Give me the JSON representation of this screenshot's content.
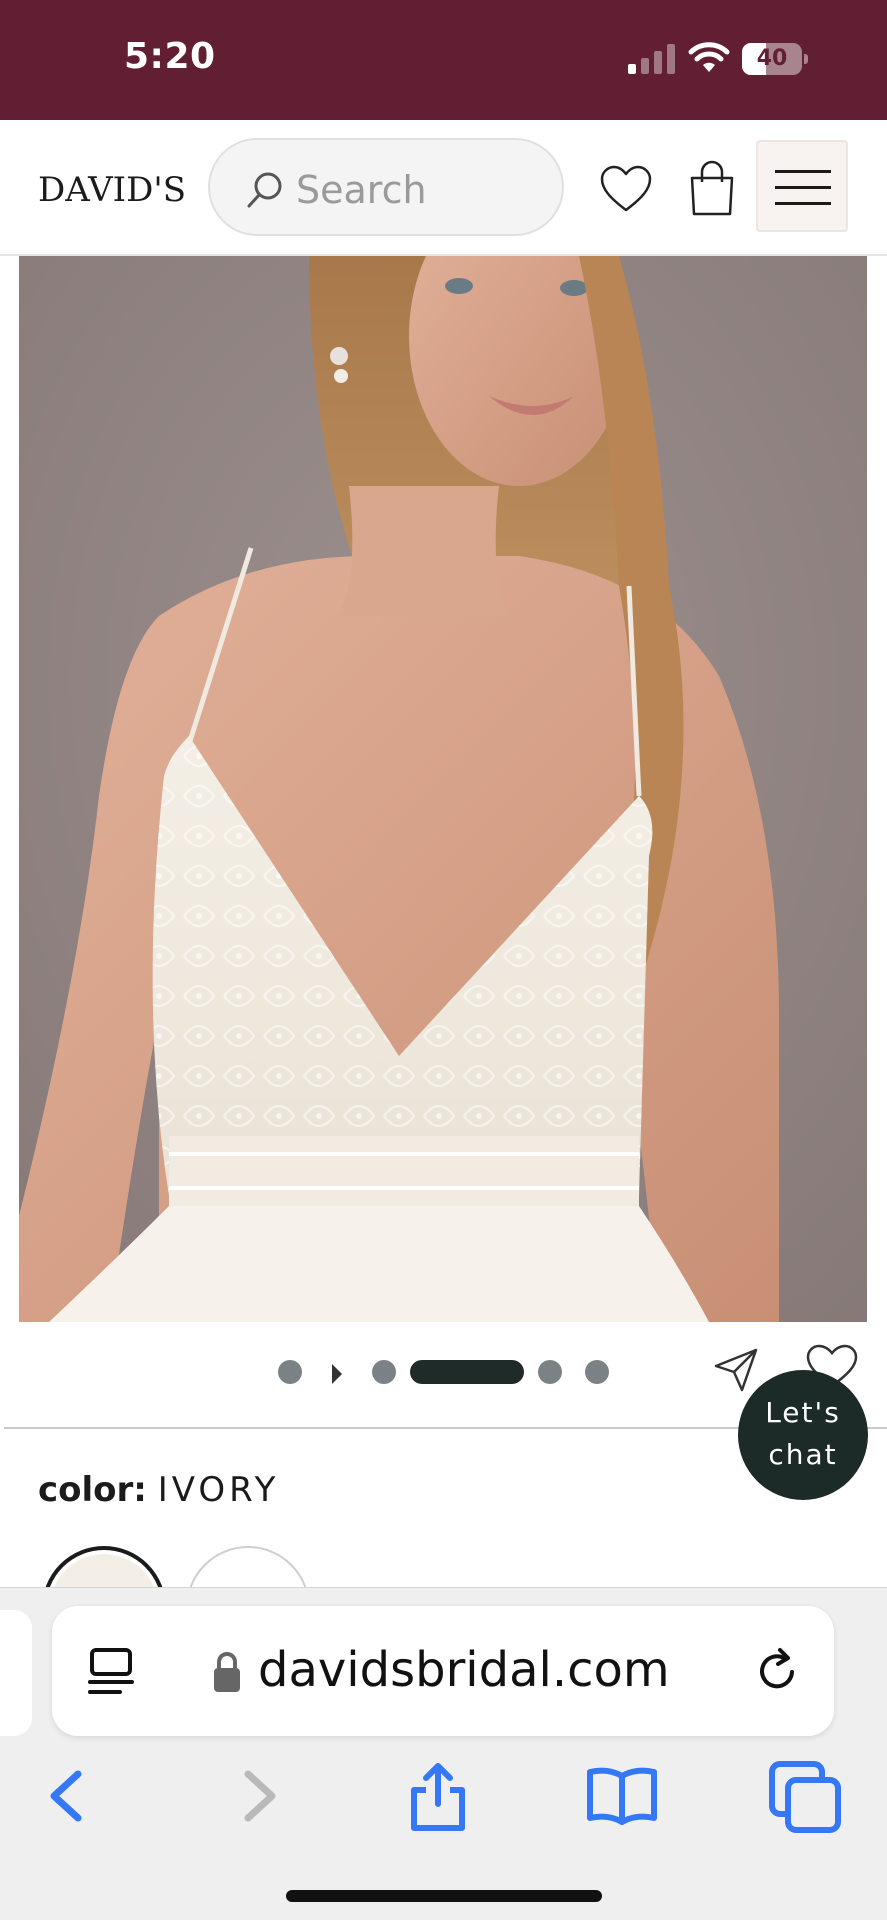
{
  "status_bar": {
    "time": "5:20",
    "battery_level": "40",
    "battery_fraction": 0.4,
    "background_color": "#621f34"
  },
  "header": {
    "logo_text": "DAVID'S",
    "search_placeholder": "Search",
    "icons": [
      "search-icon",
      "heart-icon",
      "shopping-bag-icon",
      "hamburger-menu-icon"
    ]
  },
  "product": {
    "image_alt": "Model wearing ivory lace-bodice wedding dress with spaghetti straps",
    "carousel": {
      "total_images": 5,
      "active_index": 2
    },
    "color_label": "color:",
    "color_value": "IVORY",
    "swatch_colors": [
      "#f3efe6",
      "#ffffff"
    ]
  },
  "chat": {
    "line1": "Let's",
    "line2": "chat",
    "color": "#1c2a28"
  },
  "browser": {
    "url": "davidsbridal.com",
    "accent_color": "#3478f6",
    "toolbar_icons": [
      "back-icon",
      "forward-icon",
      "share-icon",
      "bookmarks-icon",
      "tabs-icon"
    ]
  }
}
